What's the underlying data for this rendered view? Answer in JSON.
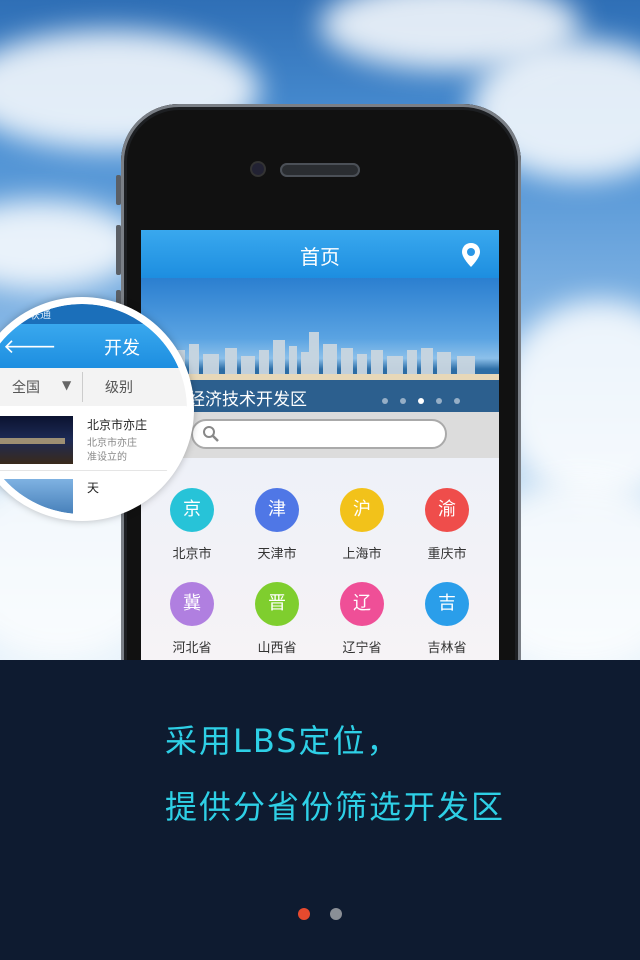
{
  "phone_screen": {
    "title": "首页",
    "banner_caption": "岛经济技术开发区",
    "search": {
      "placeholder": ""
    },
    "regions": [
      {
        "char": "京",
        "label": "北京市",
        "color": "#27c3d8"
      },
      {
        "char": "津",
        "label": "天津市",
        "color": "#4f77e6"
      },
      {
        "char": "沪",
        "label": "上海市",
        "color": "#f2c21a"
      },
      {
        "char": "渝",
        "label": "重庆市",
        "color": "#ef4d4b"
      },
      {
        "char": "冀",
        "label": "河北省",
        "color": "#b07fe0"
      },
      {
        "char": "晋",
        "label": "山西省",
        "color": "#7fce2e"
      },
      {
        "char": "辽",
        "label": "辽宁省",
        "color": "#ef4f97"
      },
      {
        "char": "吉",
        "label": "吉林省",
        "color": "#2a9eea"
      }
    ]
  },
  "magnifier": {
    "status_text": "联通",
    "header_title": "开发",
    "filter_all": "全国",
    "filter_level": "级别",
    "item_title": "北京市亦庄",
    "item_desc_1": "北京市亦庄",
    "item_desc_2": "准设立的",
    "item2_title": "天"
  },
  "slogan": {
    "line1": "采用LBS定位，",
    "line2": "提供分省份筛选开发区"
  },
  "pager": {
    "active_color": "#e64a2e",
    "inactive_color": "#8a8f96"
  }
}
